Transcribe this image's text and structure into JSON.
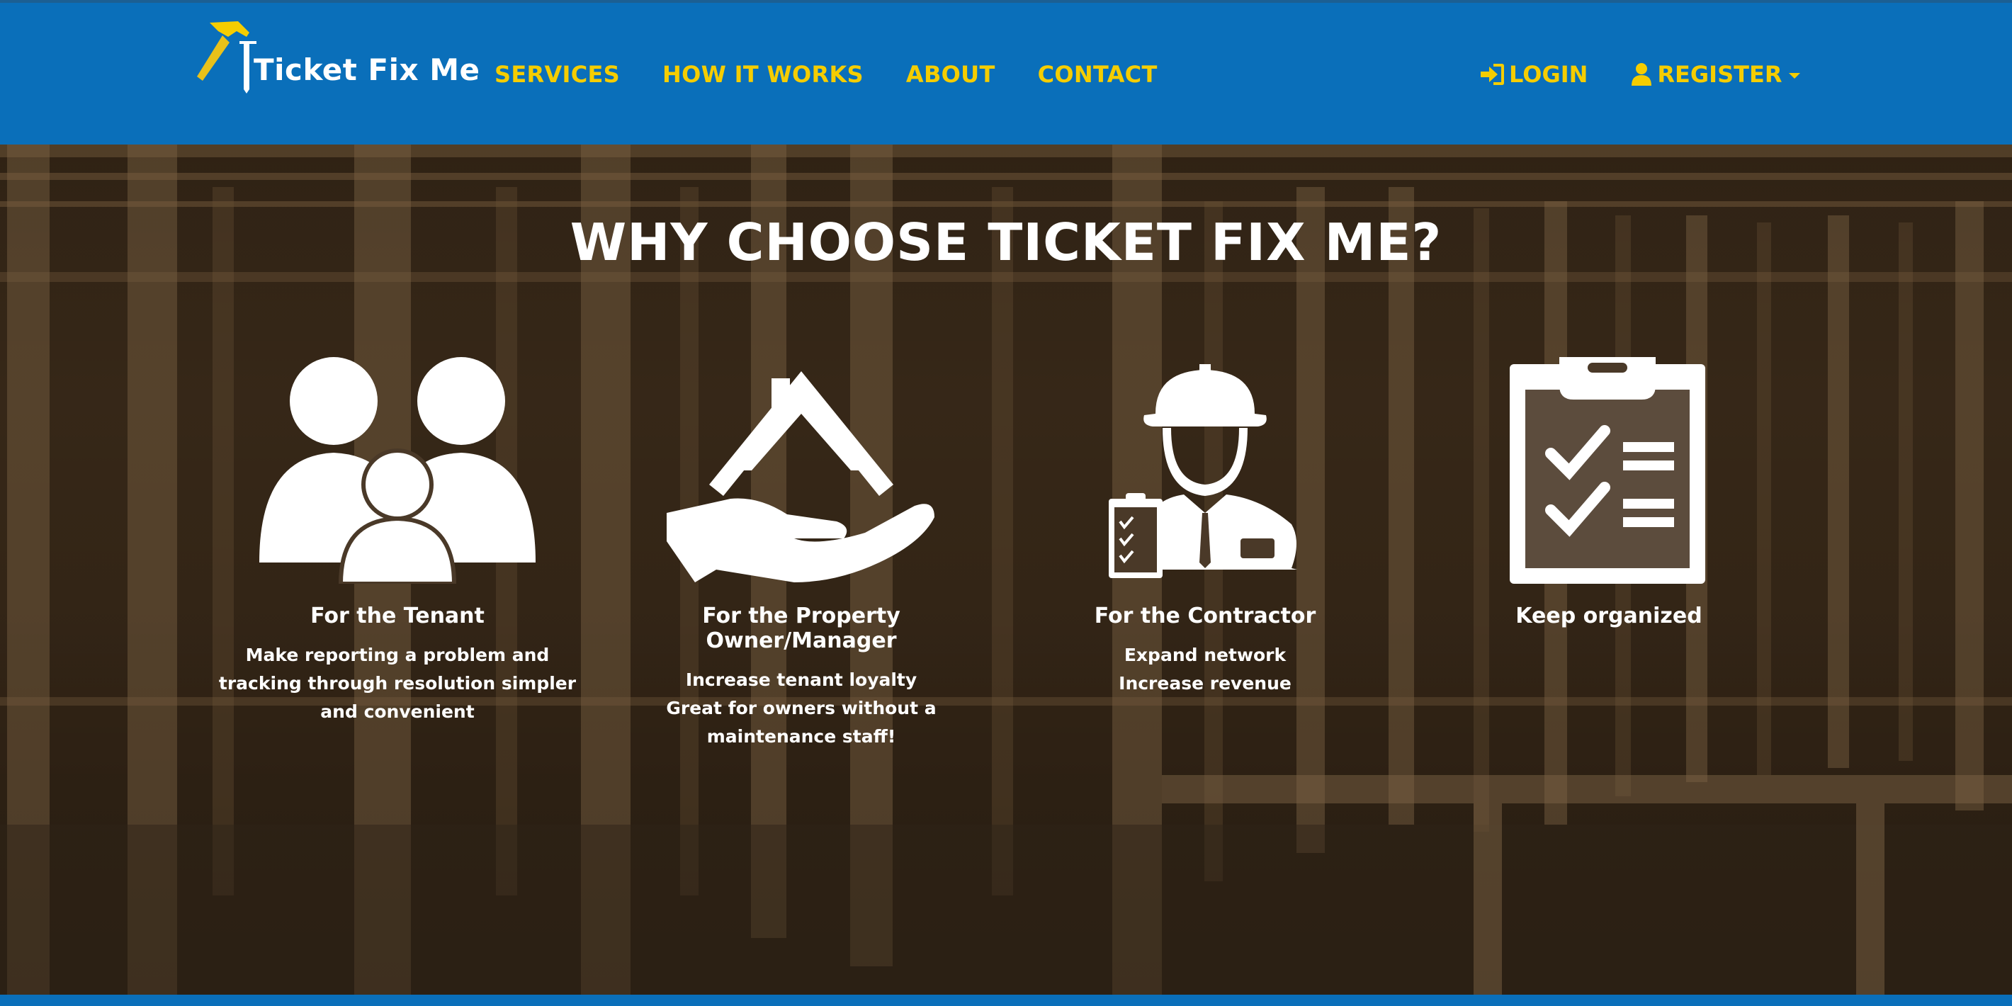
{
  "colors": {
    "nav_bg": "#0a6fba",
    "accent": "#f5cd00",
    "text": "#ffffff"
  },
  "brand": {
    "name": "Ticket Fix Me",
    "icon": "hammer-icon"
  },
  "nav": {
    "links": [
      "SERVICES",
      "HOW IT WORKS",
      "ABOUT",
      "CONTACT"
    ],
    "login_label": "LOGIN",
    "login_icon": "sign-in-icon",
    "register_label": "REGISTER",
    "register_icon": "user-icon"
  },
  "hero": {
    "title": "WHY CHOOSE TICKET FIX ME?",
    "features": [
      {
        "icon": "family-icon",
        "title": "For the Tenant",
        "lines": [
          "Make reporting a problem and tracking through resolution simpler and convenient"
        ]
      },
      {
        "icon": "house-in-hand-icon",
        "title": "For the Property Owner/Manager",
        "lines": [
          "Increase tenant loyalty",
          "Great for owners without a maintenance staff!"
        ]
      },
      {
        "icon": "contractor-icon",
        "title": "For the Contractor",
        "lines": [
          "Expand network",
          "Increase revenue"
        ]
      },
      {
        "icon": "clipboard-checklist-icon",
        "title": "Keep organized",
        "lines": []
      }
    ]
  }
}
